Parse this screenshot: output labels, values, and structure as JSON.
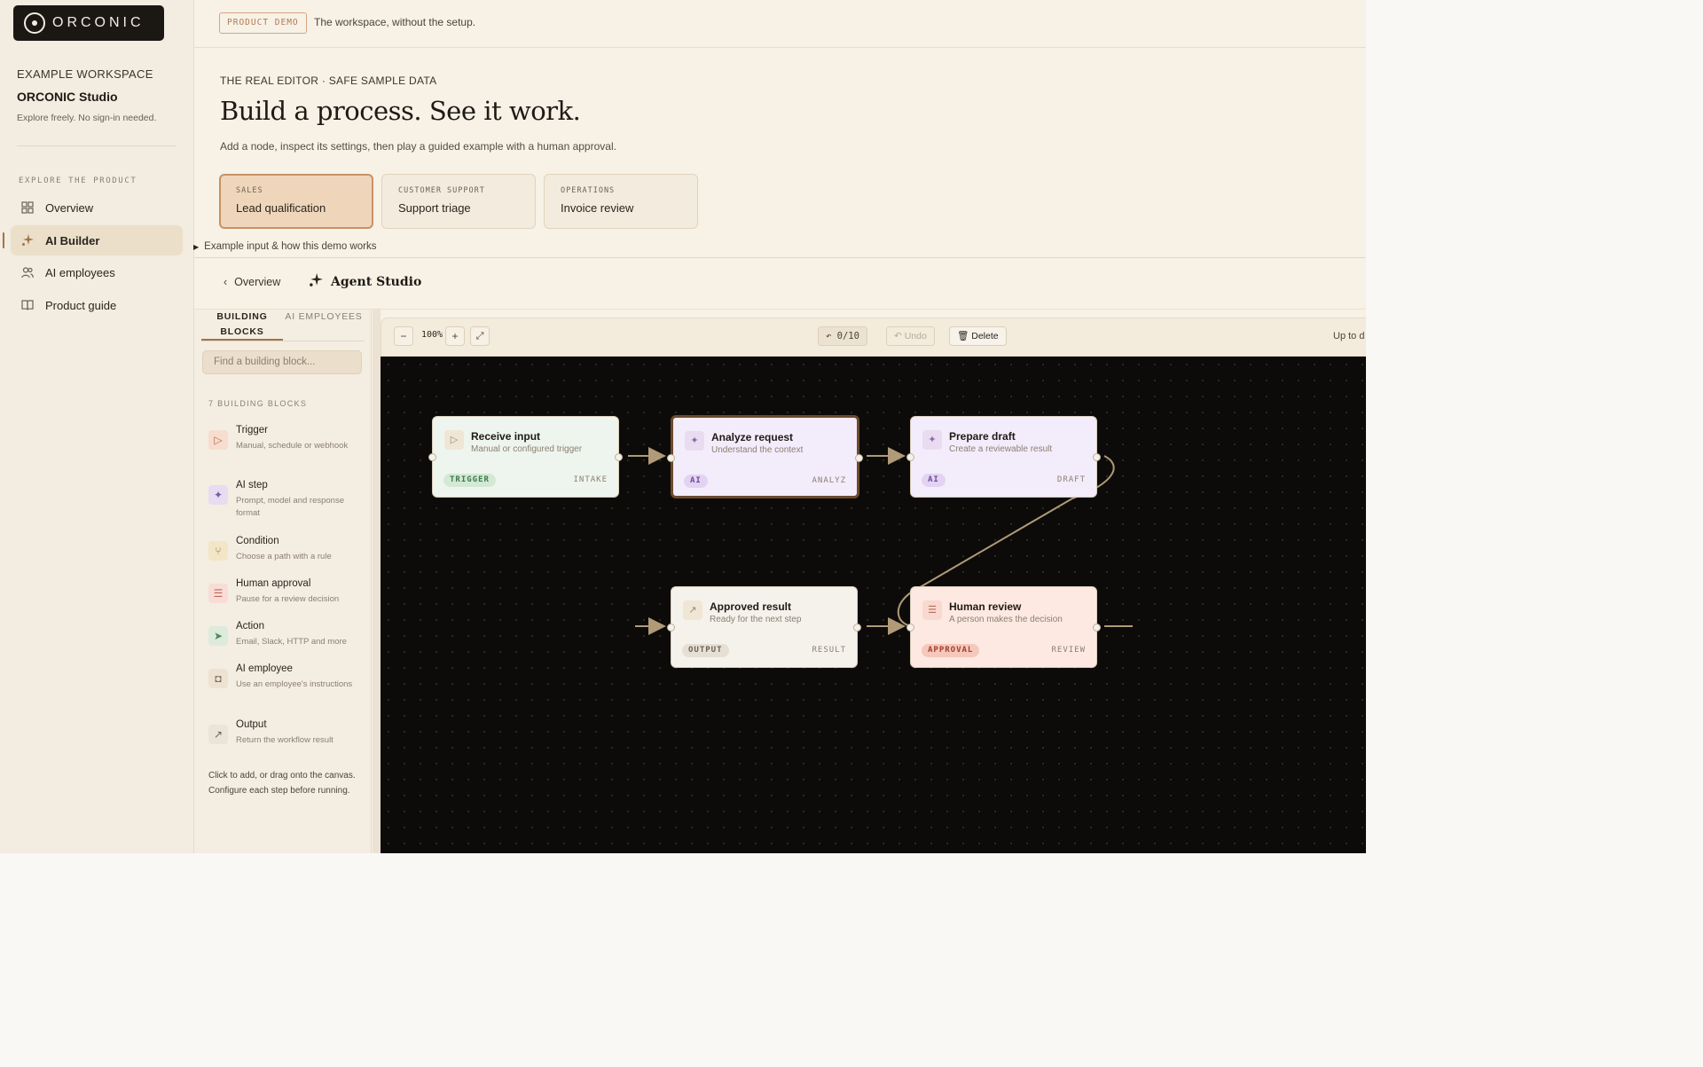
{
  "brand": {
    "name": "ORCONIC"
  },
  "topbar": {
    "badge": "PRODUCT DEMO",
    "tagline": "The workspace, without the setup."
  },
  "sidebar": {
    "workspace_label": "EXAMPLE WORKSPACE",
    "workspace_name": "ORCONIC Studio",
    "workspace_desc": "Explore freely. No sign-in needed.",
    "section": "EXPLORE THE PRODUCT",
    "items": [
      {
        "label": "Overview",
        "icon": "grid-icon"
      },
      {
        "label": "AI Builder",
        "icon": "sparkle-icon",
        "active": true
      },
      {
        "label": "AI employees",
        "icon": "users-icon"
      },
      {
        "label": "Product guide",
        "icon": "book-icon"
      }
    ]
  },
  "hero": {
    "eyebrow": "THE REAL EDITOR · SAFE SAMPLE DATA",
    "title": "Build a process. See it work.",
    "subtitle": "Add a node, inspect its settings, then play a guided example with a human approval."
  },
  "scenarios": [
    {
      "kicker": "SALES",
      "label": "Lead qualification",
      "active": true
    },
    {
      "kicker": "CUSTOMER SUPPORT",
      "label": "Support triage"
    },
    {
      "kicker": "OPERATIONS",
      "label": "Invoice review"
    }
  ],
  "example_toggle": "Example input & how this demo works",
  "studio": {
    "back_label": "Overview",
    "title": "Agent Studio"
  },
  "blocks_panel": {
    "tabs": [
      "BUILDING BLOCKS",
      "AI EMPLOYEES"
    ],
    "search_placeholder": "Find a building block...",
    "count_label": "7 BUILDING BLOCKS",
    "blocks": [
      {
        "name": "Trigger",
        "desc": "Manual, schedule or webhook",
        "icon": "play-icon"
      },
      {
        "name": "AI step",
        "desc": "Prompt, model and response format",
        "icon": "sparkle-icon"
      },
      {
        "name": "Condition",
        "desc": "Choose a path with a rule",
        "icon": "branch-icon"
      },
      {
        "name": "Human approval",
        "desc": "Pause for a review decision",
        "icon": "checklist-icon"
      },
      {
        "name": "Action",
        "desc": "Email, Slack, HTTP and more",
        "icon": "send-icon"
      },
      {
        "name": "AI employee",
        "desc": "Use an employee's instructions",
        "icon": "robot-icon"
      },
      {
        "name": "Output",
        "desc": "Return the workflow result",
        "icon": "arrow-up-right-icon"
      }
    ],
    "footer": "Click to add, or drag onto the canvas. Configure each step before running."
  },
  "toolbar": {
    "zoom_out": "−",
    "zoom": "100%",
    "zoom_in": "+",
    "fit": "⤢",
    "history": "0/10",
    "undo": "Undo",
    "delete": "Delete",
    "status": "Up to d"
  },
  "nodes": [
    {
      "id": "receive",
      "title": "Receive input",
      "subtitle": "Manual or configured trigger",
      "tag": "TRIGGER",
      "key": "INTAKE",
      "icon": "play-icon"
    },
    {
      "id": "analyze",
      "title": "Analyze request",
      "subtitle": "Understand the context",
      "tag": "AI",
      "key": "ANALYZ",
      "icon": "sparkle-icon"
    },
    {
      "id": "draft",
      "title": "Prepare draft",
      "subtitle": "Create a reviewable result",
      "tag": "AI",
      "key": "DRAFT",
      "icon": "sparkle-icon"
    },
    {
      "id": "approved",
      "title": "Approved result",
      "subtitle": "Ready for the next step",
      "tag": "OUTPUT",
      "key": "RESULT",
      "icon": "arrow-up-right-icon"
    },
    {
      "id": "review",
      "title": "Human review",
      "subtitle": "A person makes the decision",
      "tag": "APPROVAL",
      "key": "REVIEW",
      "icon": "checklist-icon"
    }
  ],
  "colors": {
    "canvas": "#0d0b09",
    "accent": "#a07447",
    "edge": "#b09a78",
    "trigger_bg": "#eef5ee",
    "ai_bg": "#f3ecfb",
    "approval_bg": "#fde9e1",
    "output_bg": "#f5f2ec"
  }
}
